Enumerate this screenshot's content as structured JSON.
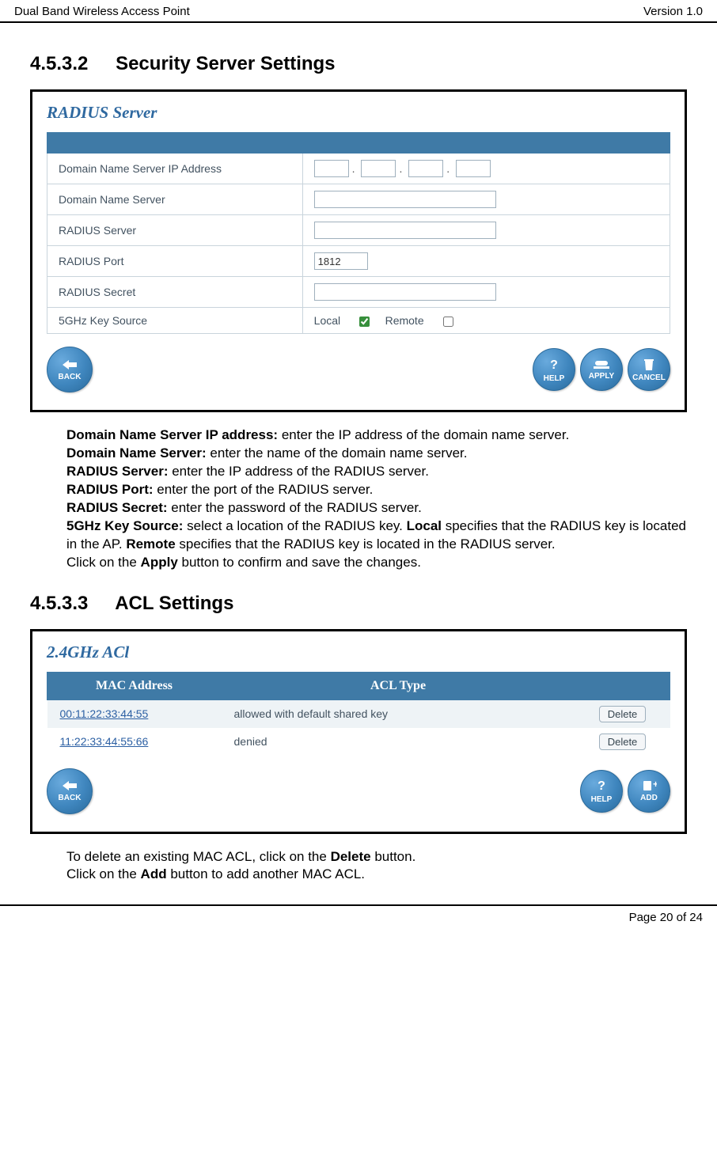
{
  "header": {
    "left": "Dual Band Wireless Access Point",
    "right": "Version 1.0"
  },
  "footer": {
    "text": "Page 20 of 24"
  },
  "sec1": {
    "num": "4.5.3.2",
    "title": "Security Server Settings",
    "panel_title": "RADIUS Server",
    "rows": {
      "dns_ip": "Domain Name Server IP Address",
      "dns": "Domain Name Server",
      "radius_server": "RADIUS Server",
      "radius_port": "RADIUS Port",
      "radius_port_value": "1812",
      "radius_secret": "RADIUS Secret",
      "key_source": "5GHz Key Source",
      "key_local": "Local",
      "key_remote": "Remote"
    },
    "buttons": {
      "back": "BACK",
      "help": "HELP",
      "apply": "APPLY",
      "cancel": "CANCEL"
    }
  },
  "desc1": {
    "l1a": "Domain Name Server IP address:",
    "l1b": " enter the IP address of the domain name server.",
    "l2a": "Domain Name Server:",
    "l2b": " enter the name of the domain name server.",
    "l3a": "RADIUS Server:",
    "l3b": " enter the IP address of the RADIUS server.",
    "l4a": "RADIUS Port:",
    "l4b": " enter the port of the RADIUS server.",
    "l5a": "RADIUS Secret:",
    "l5b": " enter the password of the RADIUS server.",
    "l6a": "5GHz Key Source:",
    "l6b": " select a location of the RADIUS key.  ",
    "l6c": "Local",
    "l6d": " specifies that the RADIUS key is located in the AP.  ",
    "l6e": "Remote",
    "l6f": " specifies that the RADIUS key is located in the RADIUS server.",
    "l7a": "Click on the ",
    "l7b": "Apply",
    "l7c": " button to confirm and save the changes."
  },
  "sec2": {
    "num": "4.5.3.3",
    "title": "ACL Settings",
    "panel_title": "2.4GHz ACl",
    "cols": {
      "mac": "MAC Address",
      "type": "ACL Type"
    },
    "rows": [
      {
        "mac": "00:11:22:33:44:55",
        "type": "allowed with default shared key",
        "del": "Delete"
      },
      {
        "mac": "11:22:33:44:55:66",
        "type": "denied",
        "del": "Delete"
      }
    ],
    "buttons": {
      "back": "BACK",
      "help": "HELP",
      "add": "ADD"
    }
  },
  "desc2": {
    "l1a": "To delete an existing MAC ACL, click on the ",
    "l1b": "Delete",
    "l1c": " button.",
    "l2a": "Click on the ",
    "l2b": "Add",
    "l2c": " button to add another MAC ACL."
  }
}
